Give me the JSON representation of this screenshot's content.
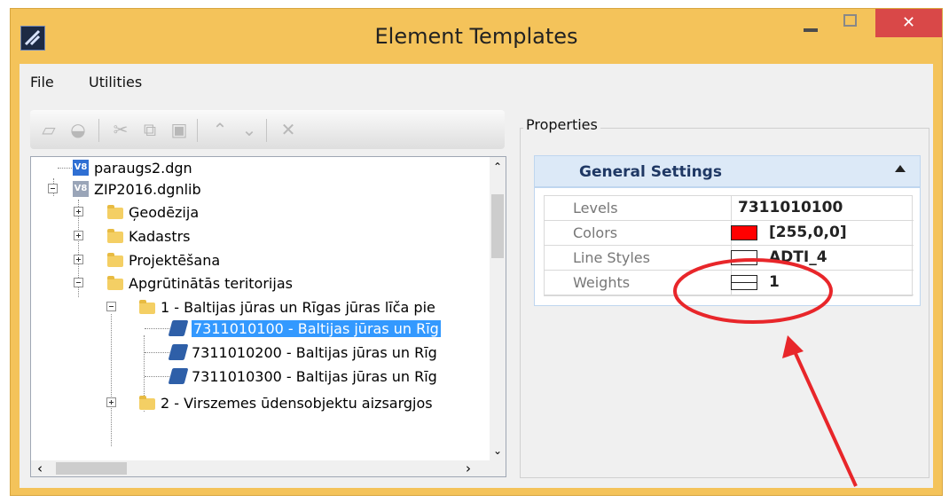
{
  "window": {
    "title": "Element Templates",
    "close_glyph": "✕"
  },
  "menu": {
    "items": [
      "File",
      "Utilities"
    ]
  },
  "toolbar": {
    "icons": [
      "open-folder-icon",
      "library-icon",
      "cut-icon",
      "copy-icon",
      "paste-icon",
      "move-up-icon",
      "move-down-icon",
      "delete-icon"
    ]
  },
  "tree": {
    "items": [
      {
        "label": "paraugs2.dgn",
        "icon": "v8-file-icon",
        "badge": "V8"
      },
      {
        "label": "ZIP2016.dgnlib",
        "icon": "v8-library-icon",
        "badge": "V8"
      },
      {
        "label": "Ģeodēzija",
        "icon": "folder-icon"
      },
      {
        "label": "Kadastrs",
        "icon": "folder-icon"
      },
      {
        "label": "Projektēšana",
        "icon": "folder-icon"
      },
      {
        "label": "Apgrūtinātās teritorijas",
        "icon": "folder-icon"
      },
      {
        "label": "1 - Baltijas jūras un Rīgas jūras līča pie",
        "icon": "folder-icon"
      },
      {
        "label": "7311010100 - Baltijas jūras un Rīg",
        "icon": "template-icon",
        "selected": true
      },
      {
        "label": "7311010200 - Baltijas jūras un Rīg",
        "icon": "template-icon"
      },
      {
        "label": "7311010300 - Baltijas jūras un Rīg",
        "icon": "template-icon"
      },
      {
        "label": "2 - Virszemes ūdensobjektu aizsargjos",
        "icon": "folder-icon"
      }
    ]
  },
  "properties": {
    "group_label": "Properties",
    "section_title": "General Settings",
    "rows": [
      {
        "name": "Levels",
        "value": "7311010100"
      },
      {
        "name": "Colors",
        "value": "[255,0,0]",
        "swatch": "#ff0000"
      },
      {
        "name": "Line Styles",
        "value": "ADTI_4"
      },
      {
        "name": "Weights",
        "value": "1"
      }
    ]
  },
  "colors": {
    "titlebar": "#f4c35a",
    "selection": "#3399ff",
    "annotation": "#e8262a"
  }
}
